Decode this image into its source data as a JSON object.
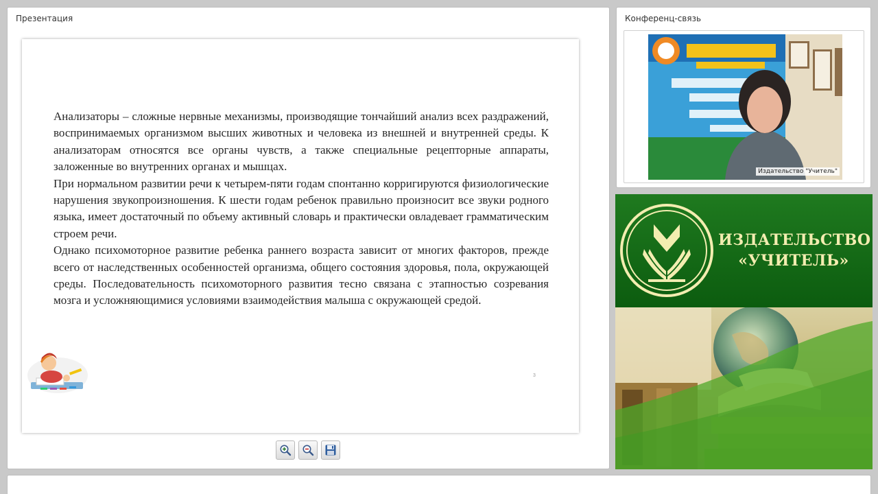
{
  "presentation": {
    "title": "Презентация",
    "slide": {
      "paragraphs": [
        "Анализаторы – сложные нервные механизмы, производящие тончайший анализ всех раздражений, воспринимаемых организмом высших животных и человека из внешней и внутренней среды. К анализаторам относятся все органы чувств, а также специальные рецепторные аппараты, заложенные во внутренних органах и мышцах.",
        "При нормальном развитии речи к четырем-пяти годам спонтанно корригируются физиологические нарушения звукопроизношения. К шести годам ребенок правильно произносит все звуки родного языка, имеет достаточный по объему активный словарь и практически овладевает грамматическим строем речи.",
        "Однако психомоторное развитие ребенка раннего возраста зависит от многих факторов, прежде всего от наследственных особенностей организма, общего состояния здоровья, пола, окружающей среды. Последовательность психомоторного развития тесно связана с этапностью созревания мозга и усложняющимися условиями взаимодействия малыша с окружающей средой."
      ],
      "page_number": "3"
    },
    "toolbar": {
      "zoom_in_icon": "zoom-in-icon",
      "zoom_out_icon": "zoom-out-icon",
      "save_icon": "floppy-disk-icon"
    }
  },
  "conference": {
    "title": "Конференц-связь",
    "participant_label": "Издательство \"Учитель\""
  },
  "banner": {
    "title_line1": "ИЗДАТЕЛЬСТВО",
    "title_line2": "«УЧИТЕЛЬ»"
  },
  "colors": {
    "banner_green": "#0c5c0f",
    "banner_text": "#f3edb0"
  }
}
